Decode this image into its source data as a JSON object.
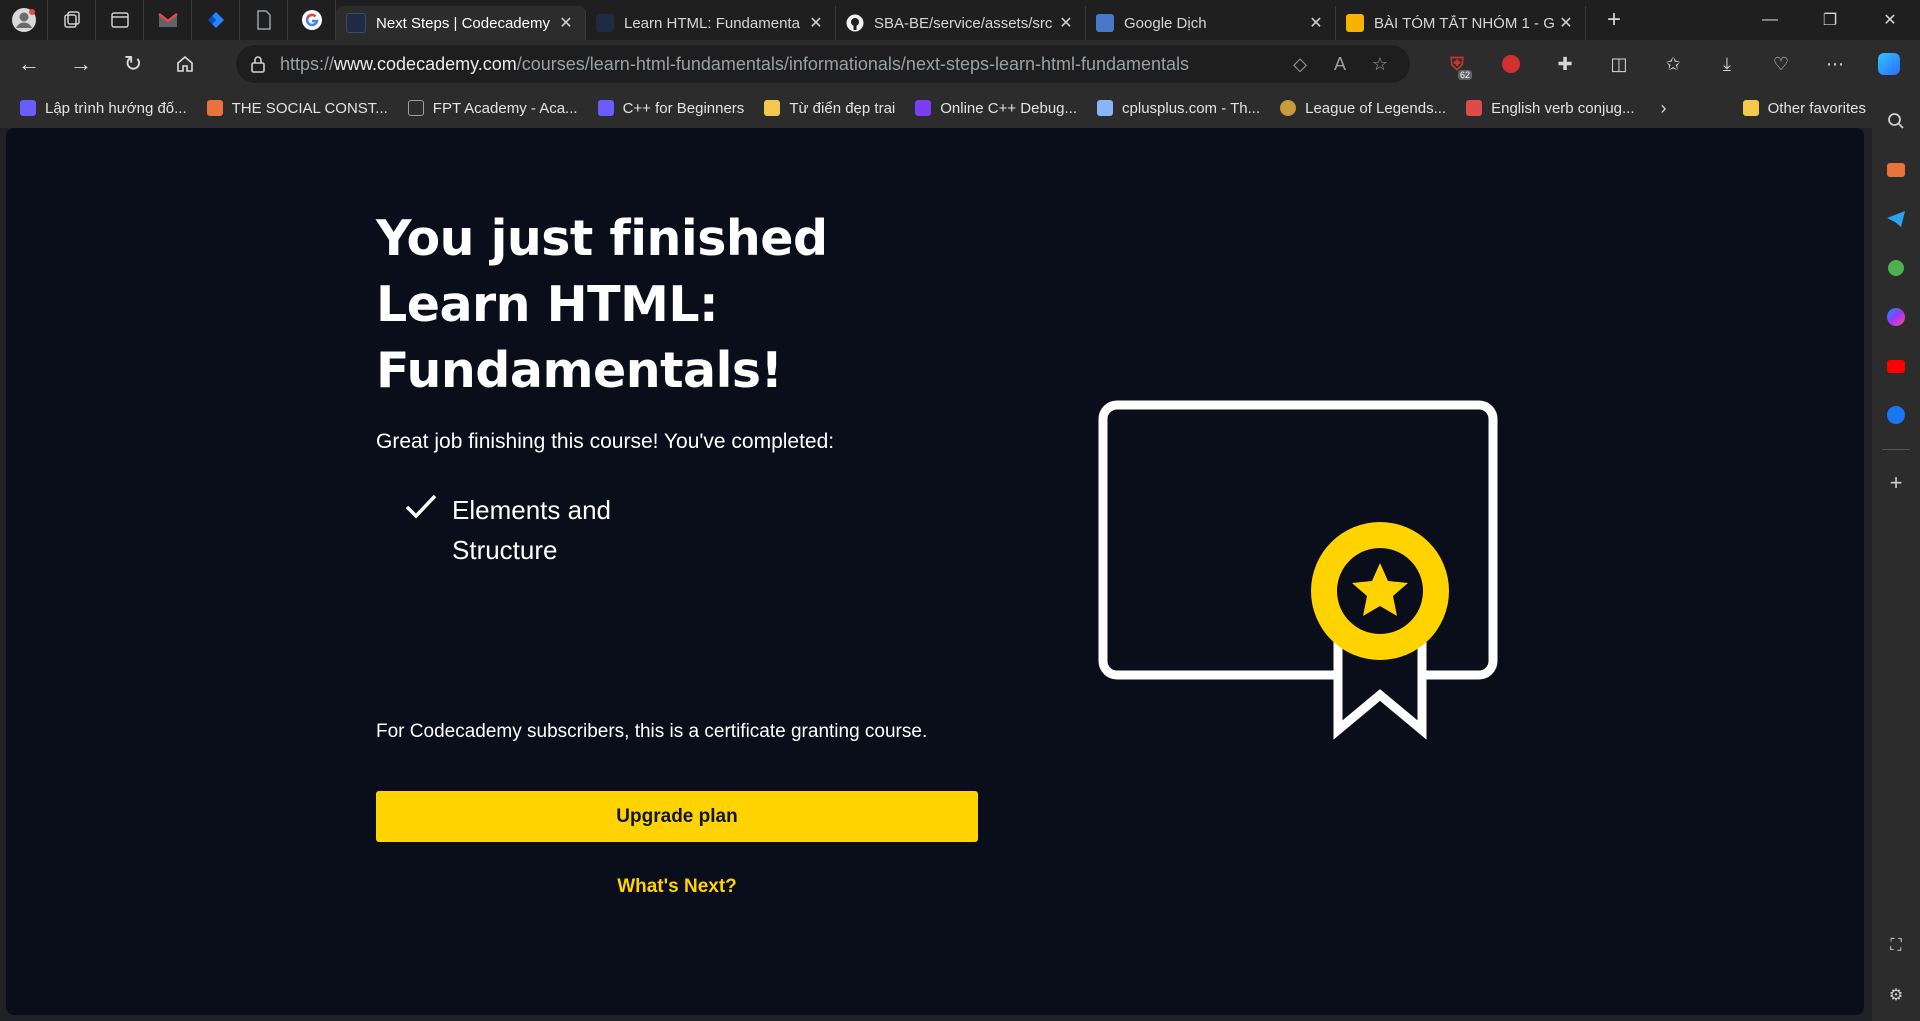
{
  "browser": {
    "pinned_tabs": [
      "profile-icon",
      "workspaces-icon",
      "tab-actions-icon",
      "gmail-icon",
      "jira-icon",
      "document-icon",
      "google-icon"
    ],
    "tabs": [
      {
        "title": "Next Steps | Codecademy",
        "favicon": "codecademy-icon",
        "active": true
      },
      {
        "title": "Learn HTML: Fundamenta",
        "favicon": "codecademy-icon",
        "active": false
      },
      {
        "title": "SBA-BE/service/assets/src",
        "favicon": "github-icon",
        "active": false
      },
      {
        "title": "Google Dịch",
        "favicon": "google-translate-icon",
        "active": false
      },
      {
        "title": "BÀI TÓM TẮT NHÓM 1 - G",
        "favicon": "google-slides-icon",
        "active": false
      }
    ],
    "new_tab": "+",
    "address": {
      "prefix": "https://",
      "host": "www.codecademy.com",
      "path": "/courses/learn-html-fundamentals/informationals/next-steps-learn-html-fundamentals"
    },
    "extension_badge": "62"
  },
  "bookmarks": [
    {
      "label": "Lập trình hướng đố...",
      "icon": "codecademy-icon",
      "color": "#6b5cff"
    },
    {
      "label": "THE SOCIAL CONST...",
      "icon": "layers-icon",
      "color": "#e8743b"
    },
    {
      "label": "FPT Academy - Aca...",
      "icon": "document-icon",
      "color": "#9aa0a6"
    },
    {
      "label": "C++ for Beginners",
      "icon": "codecademy-icon",
      "color": "#6b5cff"
    },
    {
      "label": "Từ điển đẹp trai",
      "icon": "folder-icon",
      "color": "#f2c94c"
    },
    {
      "label": "Online C++ Debug...",
      "icon": "bolt-icon",
      "color": "#7b3ff2"
    },
    {
      "label": "cplusplus.com - Th...",
      "icon": "cplusplus-icon",
      "color": "#8ab4f8"
    },
    {
      "label": "League of Legends...",
      "icon": "lol-icon",
      "color": "#c89b3c"
    },
    {
      "label": "English verb conjug...",
      "icon": "reverso-icon",
      "color": "#e04a4a"
    }
  ],
  "bookmarks_other": "Other favorites",
  "page": {
    "headline": "You just finished Learn HTML: Fundamentals!",
    "subtitle": "Great job finishing this course! You've completed:",
    "completed_items": [
      "Elements and Structure"
    ],
    "certificate_note": "For Codecademy subscribers, this is a certificate granting course.",
    "upgrade_label": "Upgrade plan",
    "next_label": "What's Next?"
  },
  "colors": {
    "page_bg": "#0a0d1a",
    "accent_yellow": "#ffd300",
    "button_text": "#10162f"
  }
}
